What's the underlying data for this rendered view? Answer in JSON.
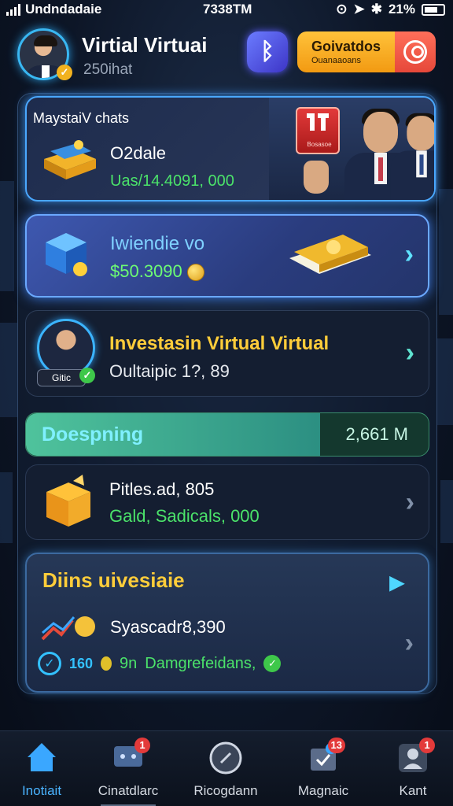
{
  "status_bar": {
    "carrier": "Undndadaie",
    "time": "7338TM",
    "battery": "21%"
  },
  "header": {
    "title": "Virtial Virtuai",
    "subtitle": "250ihat",
    "bt_icon": "bluetooth-icon",
    "gold_button_line1": "Goivatdos",
    "gold_button_line2": "Ouanaaoans",
    "profile_icon": "user-circle-icon"
  },
  "cards": {
    "c1": {
      "kicker": "MaystaiV chats",
      "title": "O2dale",
      "value": "Uas/14.4091, 000",
      "logo_label": "Bosasoe"
    },
    "c2": {
      "title": "Iwiendie vo",
      "value": "$50.3090"
    },
    "c3": {
      "title": "Investasin Virtual Virtual",
      "value": "Oultaipic 1?, 89",
      "tag": "Gitic"
    },
    "progress": {
      "label": "Doespning",
      "value": "2,661 M",
      "fill_fraction": 0.73
    },
    "c4": {
      "title": "Pitles.ad, 805",
      "value": "Gald, Sadicals, 000"
    },
    "c5": {
      "title": "Diins uivesiaie",
      "row1": "Syascadr8,390",
      "row2_pct": "160",
      "row2_prefix": "9n",
      "row2_text": "Damgrefeidans,"
    }
  },
  "tabs": [
    {
      "label": "Inotiait",
      "active": true
    },
    {
      "label": "Cinatdlarc",
      "badge": "1"
    },
    {
      "label": "Ricogdann"
    },
    {
      "label": "Magnaic",
      "badge": "13"
    },
    {
      "label": "Kant",
      "badge": "1"
    }
  ],
  "colors": {
    "accent": "#4ab3ff",
    "gold": "#ffcd3a",
    "green": "#4be36a"
  }
}
